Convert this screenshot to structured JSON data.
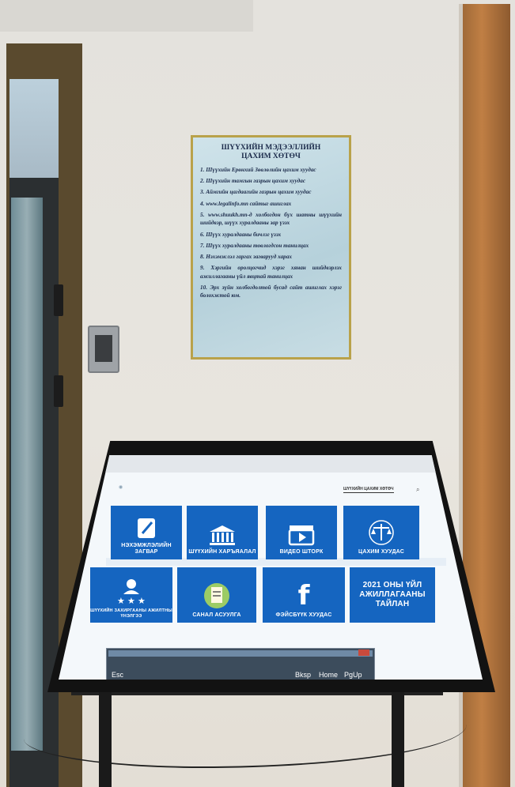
{
  "poster": {
    "title_line1": "ШҮҮХИЙН МЭДЭЭЛЛИЙН",
    "title_line2": "ЦАХИМ ХӨТӨЧ",
    "items": [
      "1. Шүүхийн Ерөнхий Зөвлөлийн цахим хуудас",
      "2. Шүүхийн тамгын газрын цахим хуудас",
      "3. Аймгийн цагдаагийн газрын цахим хуудас",
      "4. www.legalinfo.mn сайтыг ашиглах",
      "5. www.shuukh.mn-д холбогдон бүх шатны шүүхийн шийдвэр, шүүх хуралдааны зар үзэх",
      "6. Шүүх хуралдааны бичлэг үзэх",
      "7. Шүүх хуралдааны товлогдсон танилцах",
      "8. Нэхэмжлэл гаргах загварууд харах",
      "9. Хэргийн оролцогчид хэрэг хянан шийдвэрлэх ажиллагааны үйл явцтай танилцах",
      "10. Эрх зүйн холбогдолтой бусад сайт ашиглах хэрэг болохжтой юм."
    ]
  },
  "screen": {
    "header_right": "ШҮҮХИЙН ЦАХИМ ХӨТӨЧ",
    "tiles": [
      {
        "label": "НЭХЭМЖЛЭЛИЙН ЗАГВАР",
        "icon": "document-pen-icon"
      },
      {
        "label": "ШҮҮХИЙН ХАРЪЯАЛАЛ",
        "icon": "courthouse-icon"
      },
      {
        "label": "ВИДЕО ШТОРК",
        "icon": "video-clapper-icon"
      },
      {
        "label": "ЦАХИМ ХУУДАС",
        "icon": "scales-of-justice-icon"
      },
      {
        "label": "ШҮҮХИЙН ЗАХИРГААНЫ АЖИЛТНЫ ҮНЭЛГЭЭ",
        "icon": "person-stars-icon"
      },
      {
        "label": "САНАЛ АСУУЛГА",
        "icon": "survey-clipboard-icon"
      },
      {
        "label": "ФЭЙСБҮҮК ХУУДАС",
        "icon": "facebook-icon"
      },
      {
        "label": "2021 ОНЫ ҮЙЛ АЖИЛЛАГААНЫ ТАЙЛАН",
        "icon": ""
      }
    ],
    "keyboard": {
      "esc": "Esc",
      "bksp": "Bksp",
      "home": "Home",
      "pgup": "PgUp"
    }
  },
  "colors": {
    "tile_blue": "#1565c0",
    "poster_frame": "#b9a24a"
  }
}
